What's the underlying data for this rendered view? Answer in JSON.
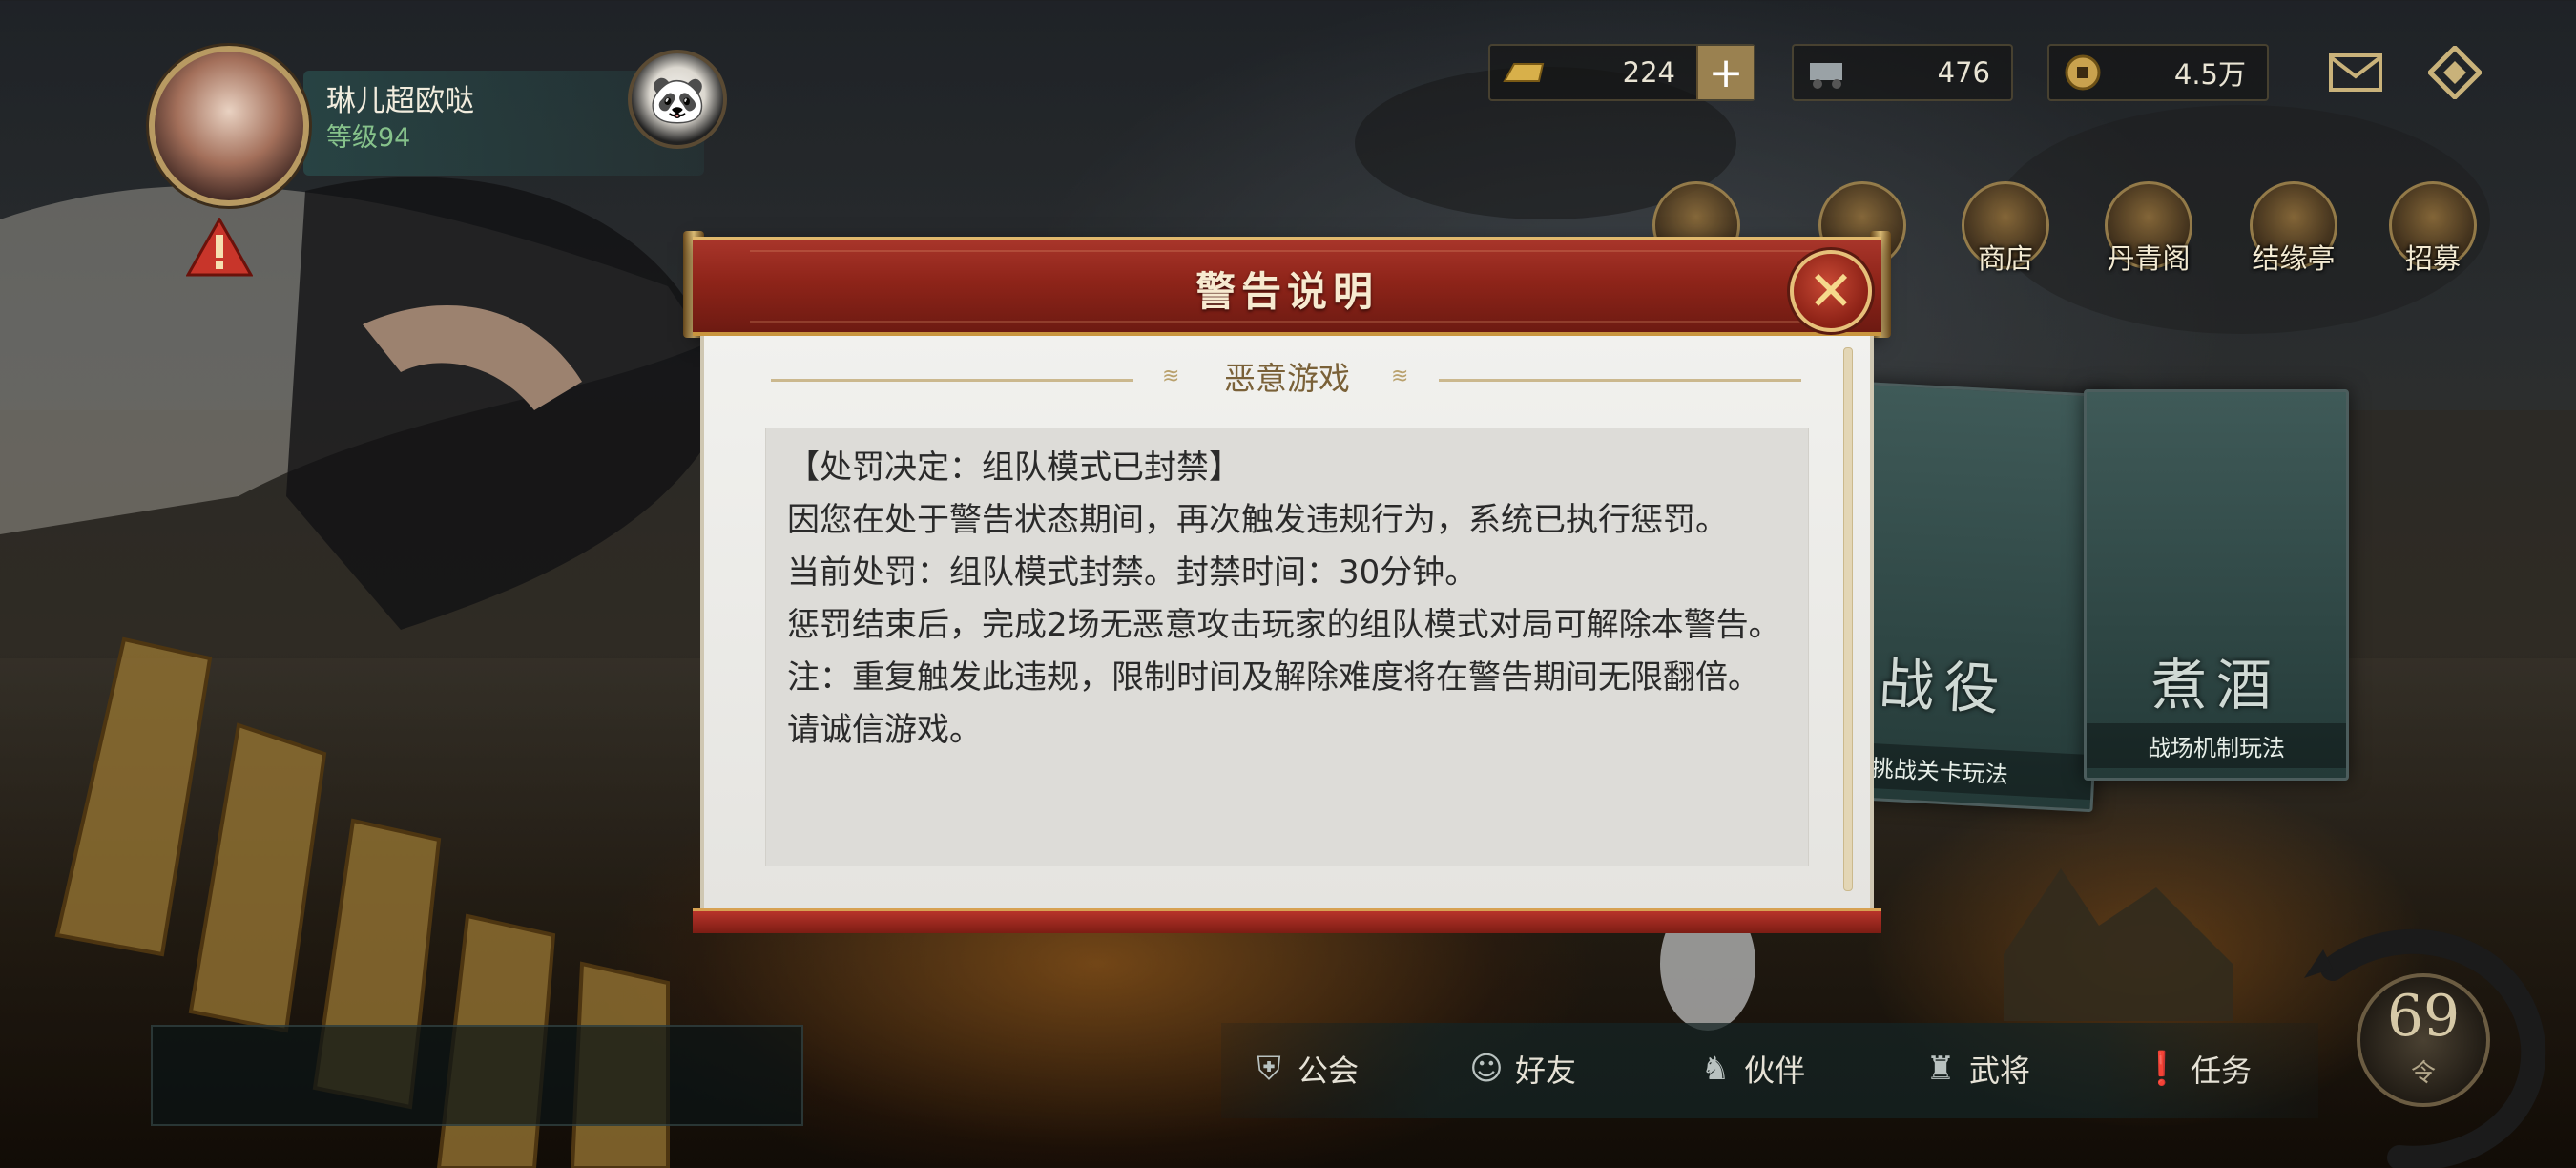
{
  "player": {
    "name": "琳儿超欧哒",
    "level": "等级94"
  },
  "currencies": [
    {
      "icon": "gold-ingot-icon",
      "value": "224",
      "has_plus": true
    },
    {
      "icon": "cart-icon",
      "value": "476",
      "has_plus": false
    },
    {
      "icon": "copper-coin-icon",
      "value": "4.5万",
      "has_plus": false
    }
  ],
  "features": [
    {
      "label": "商店"
    },
    {
      "label": "丹青阁"
    },
    {
      "label": "结缘亭"
    },
    {
      "label": "招募"
    }
  ],
  "mode_cards": [
    {
      "title": "战役",
      "subtitle": "挑战关卡玩法"
    },
    {
      "title": "煮酒",
      "subtitle": "战场机制玩法"
    }
  ],
  "bottom_nav": [
    {
      "label": "公会",
      "icon": "guild-icon"
    },
    {
      "label": "好友",
      "icon": "friend-icon"
    },
    {
      "label": "伙伴",
      "icon": "partner-icon"
    },
    {
      "label": "武将",
      "icon": "general-icon"
    },
    {
      "label": "任务",
      "icon": "task-icon"
    }
  ],
  "level_badge": {
    "value": "69",
    "label": "令"
  },
  "dialog": {
    "title": "警告说明",
    "subheader": "恶意游戏",
    "lines": [
      "【处罚决定：组队模式已封禁】",
      "因您在处于警告状态期间，再次触发违规行为，系统已执行惩罚。",
      "当前处罚：组队模式封禁。封禁时间：30分钟。",
      "惩罚结束后，完成2场无恶意攻击玩家的组队模式对局可解除本警告。",
      "注：重复触发此违规，限制时间及解除难度将在警告期间无限翻倍。请诚信游戏。"
    ]
  },
  "colors": {
    "dialog_header": "#8e2419",
    "dialog_body": "#f1f1ee",
    "gold_trim": "#e1b96d",
    "level_green": "#86c28b"
  }
}
